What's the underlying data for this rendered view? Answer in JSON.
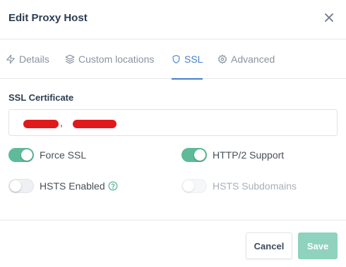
{
  "dialog": {
    "title": "Edit Proxy Host"
  },
  "tabs": [
    {
      "label": "Details",
      "icon": "zap-icon"
    },
    {
      "label": "Custom locations",
      "icon": "layers-icon"
    },
    {
      "label": "SSL",
      "icon": "shield-icon",
      "active": true
    },
    {
      "label": "Advanced",
      "icon": "settings-icon"
    }
  ],
  "ssl": {
    "certificate_label": "SSL Certificate",
    "certificate_separator": ",",
    "options": {
      "force_ssl": {
        "label": "Force SSL",
        "enabled": true
      },
      "http2_support": {
        "label": "HTTP/2 Support",
        "enabled": true
      },
      "hsts_enabled": {
        "label": "HSTS Enabled",
        "enabled": false
      },
      "hsts_subdomains": {
        "label": "HSTS Subdomains",
        "enabled": false,
        "disabled": true
      }
    }
  },
  "footer": {
    "cancel_label": "Cancel",
    "save_label": "Save"
  },
  "colors": {
    "accent": "#467fcf",
    "toggle_on": "#5eba98",
    "save_button": "#8fd2bd",
    "redaction": "#e0191c"
  }
}
